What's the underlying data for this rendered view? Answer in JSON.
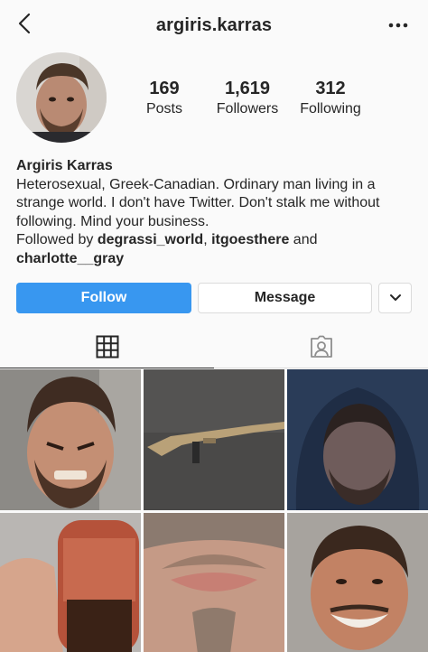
{
  "header": {
    "username": "argiris.karras",
    "back_icon": "chevron-left-icon",
    "more_icon": "more-horizontal-icon"
  },
  "profile": {
    "stats": [
      {
        "value": "169",
        "label": "Posts"
      },
      {
        "value": "1,619",
        "label": "Followers"
      },
      {
        "value": "312",
        "label": "Following"
      }
    ]
  },
  "bio": {
    "name": "Argiris Karras",
    "text": "Heterosexual, Greek-Canadian. Ordinary man living in a strange world. I don't have Twitter. Don't stalk me without following. Mind your business.",
    "followed_by_prefix": "Followed by ",
    "followed_by_user1": "degrassi_world",
    "separator": ", ",
    "followed_by_user2": "itgoesthere",
    "and_text": " and",
    "followed_by_user3": "charlotte__gray"
  },
  "actions": {
    "follow_label": "Follow",
    "message_label": "Message"
  },
  "tabs": [
    {
      "name": "grid",
      "icon": "grid-icon",
      "active": true
    },
    {
      "name": "tagged",
      "icon": "tagged-person-icon",
      "active": false
    }
  ],
  "colors": {
    "accent": "#3897f0",
    "border": "#dbdbdb",
    "background": "#fafafa",
    "text": "#262626"
  },
  "posts": [
    {
      "name": "post-face-grimace"
    },
    {
      "name": "post-rifle"
    },
    {
      "name": "post-face-hood"
    },
    {
      "name": "post-iced-capp"
    },
    {
      "name": "post-lips-closeup"
    },
    {
      "name": "post-face-smile"
    }
  ]
}
